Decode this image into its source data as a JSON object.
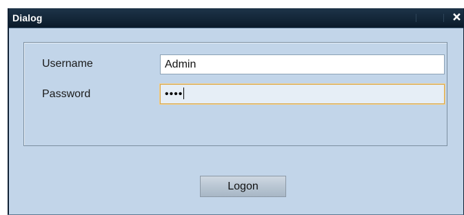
{
  "dialog": {
    "title": "Dialog",
    "close_icon": "close-icon"
  },
  "form": {
    "username_label": "Username",
    "username_value": "Admin",
    "password_label": "Password",
    "password_mask": "••••"
  },
  "actions": {
    "logon_label": "Logon"
  },
  "colors": {
    "titlebar": "#132638",
    "dialog_body": "#c2d5e9",
    "focus_border": "#d9a84a"
  }
}
